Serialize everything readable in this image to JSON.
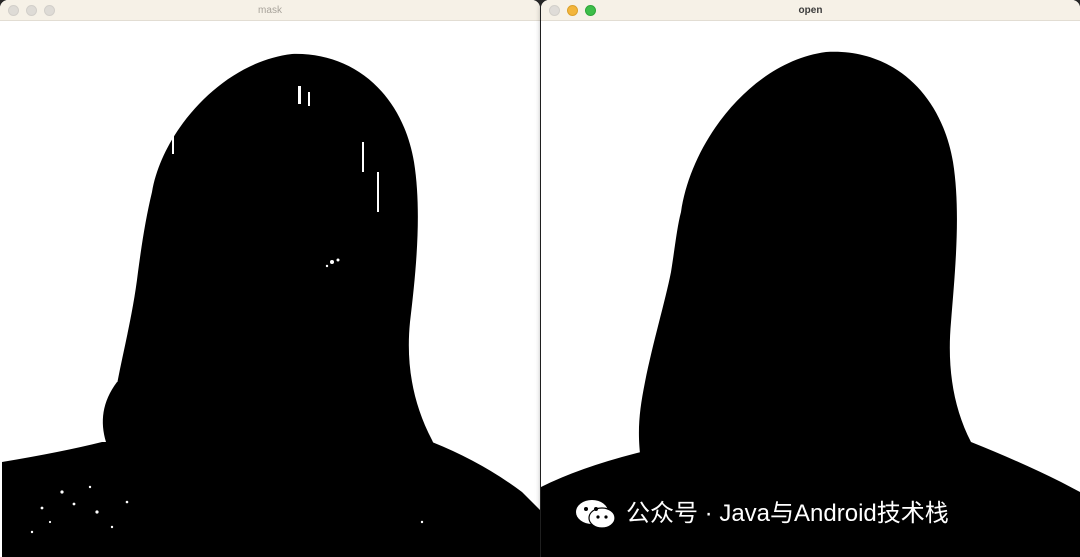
{
  "windows": [
    {
      "title": "mask",
      "state": "inactive",
      "image": "binary-mask-silhouette-noisy"
    },
    {
      "title": "open",
      "state": "active",
      "image": "binary-mask-silhouette-opened"
    }
  ],
  "watermark": {
    "icon": "wechat-icon",
    "text": "公众号 · Java与Android技术栈"
  },
  "colors": {
    "titlebar": "#f6f1e7",
    "foreground": "#000000",
    "background": "#ffffff",
    "close": "#dfdcd8",
    "minimize": "#f3b53b",
    "maximize": "#3dbe4a"
  }
}
